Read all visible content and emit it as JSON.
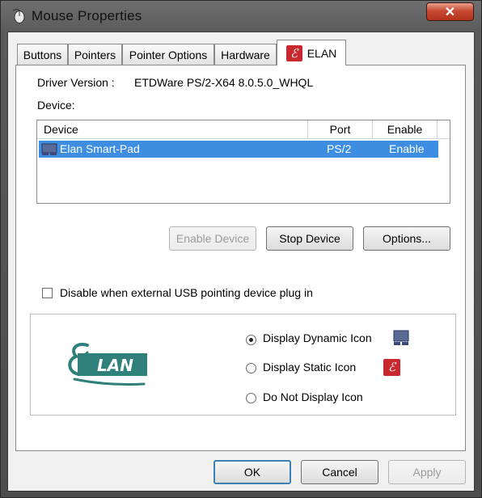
{
  "window": {
    "title": "Mouse Properties",
    "close_glyph": "✕"
  },
  "tabs": [
    {
      "label": "Buttons"
    },
    {
      "label": "Pointers"
    },
    {
      "label": "Pointer Options"
    },
    {
      "label": "Hardware"
    },
    {
      "label": "ELAN",
      "active": true,
      "icon": "elan-icon"
    }
  ],
  "elan_tab": {
    "driver_version_label": "Driver Version :",
    "driver_version_value": "ETDWare PS/2-X64 8.0.5.0_WHQL",
    "device_label": "Device:",
    "device_list": {
      "columns": [
        "Device",
        "Port",
        "Enable"
      ],
      "rows": [
        {
          "device": "Elan Smart-Pad",
          "port": "PS/2",
          "enable": "Enable",
          "icon": "touchpad-icon",
          "selected": true
        }
      ]
    },
    "buttons": {
      "enable_device": "Enable Device",
      "stop_device": "Stop Device",
      "options": "Options..."
    },
    "disable_usb_label": "Disable when external USB pointing device plug in",
    "disable_usb_checked": false,
    "logo_text": "LAN",
    "logo_letter": "E",
    "icon_options": {
      "dynamic": "Display Dynamic Icon",
      "static": "Display Static Icon",
      "none": "Do Not Display Icon",
      "selected": "dynamic"
    }
  },
  "dialog_buttons": {
    "ok": "OK",
    "cancel": "Cancel",
    "apply": "Apply"
  },
  "colors": {
    "selection": "#3d8ee0",
    "elan_red": "#c8282e",
    "elan_teal": "#2f7f7a"
  }
}
